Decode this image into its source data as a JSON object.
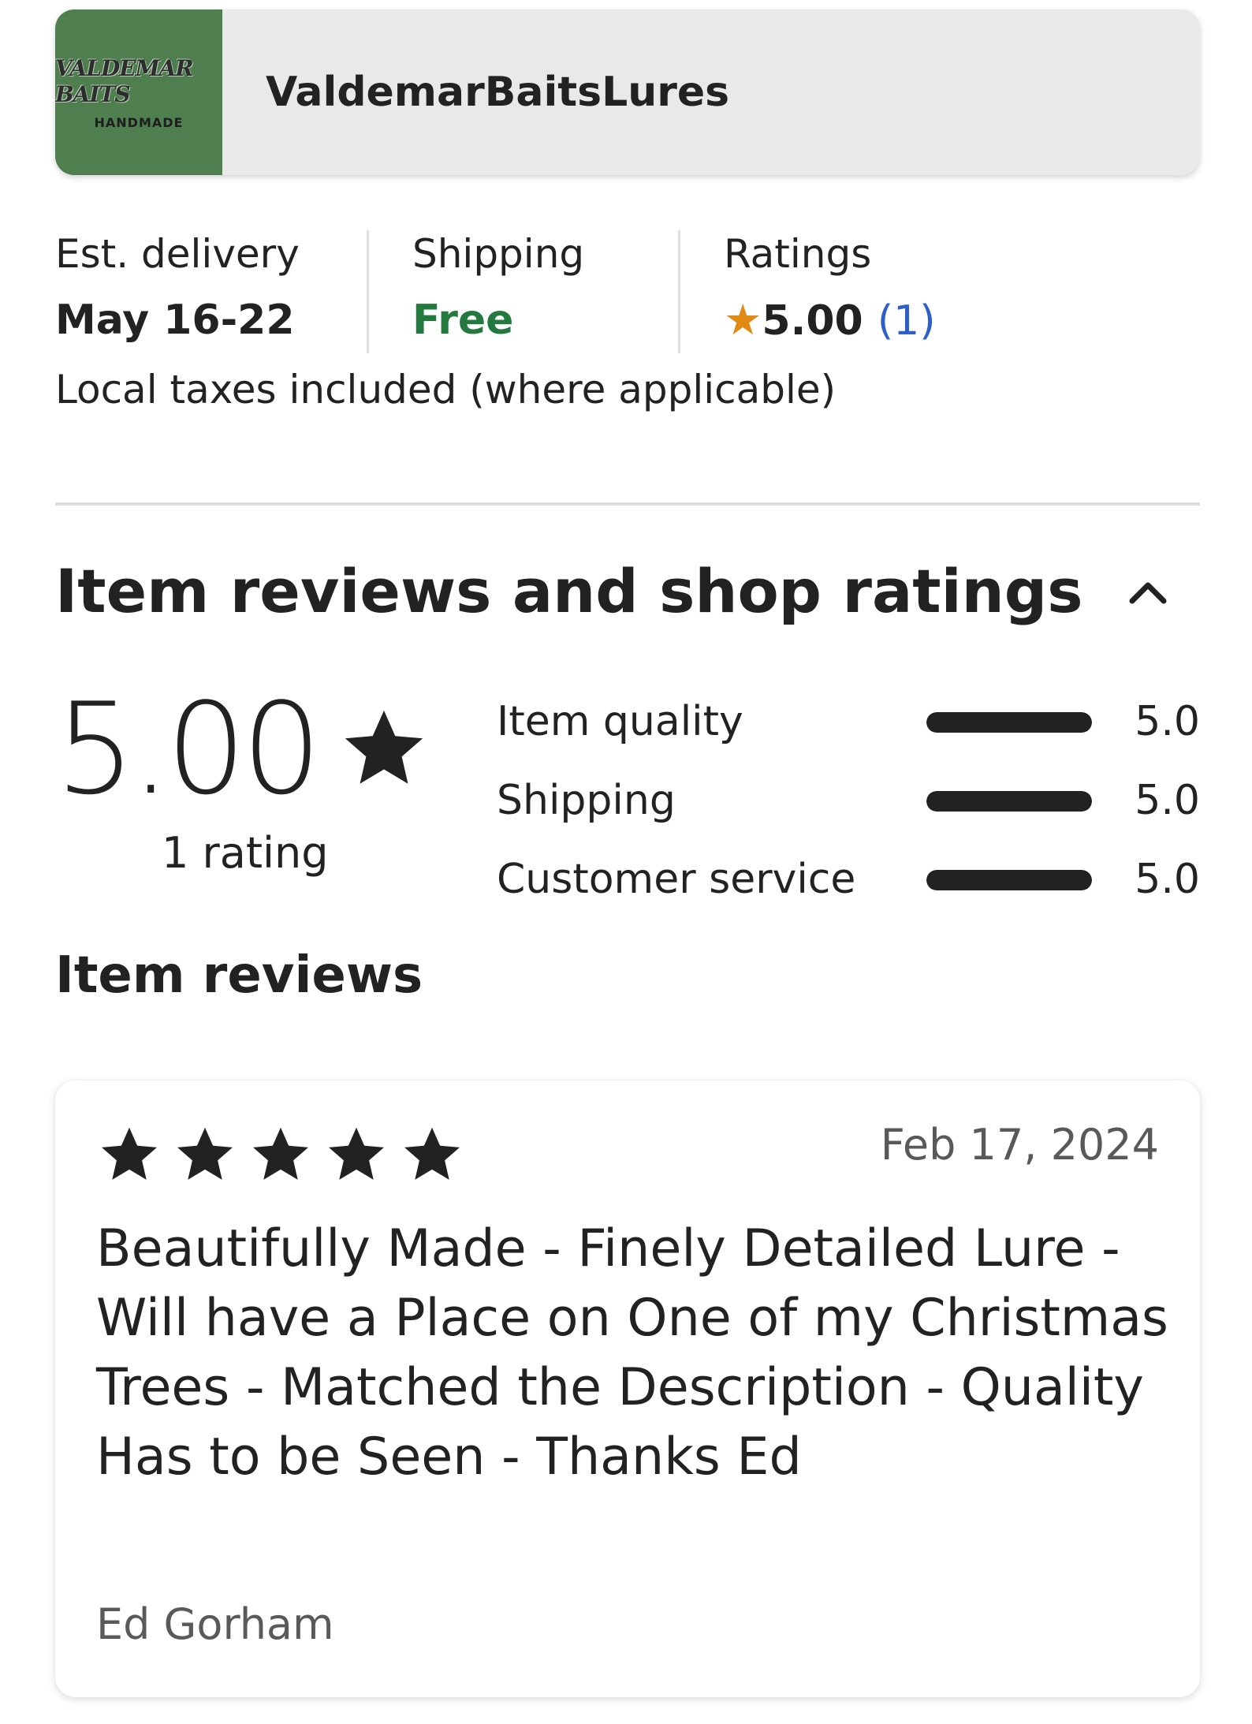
{
  "shop": {
    "logo_text": "VALDEMAR BAITS",
    "logo_subtext": "HANDMADE",
    "name": "ValdemarBaitsLures",
    "logo_color": "#4f7f4f"
  },
  "delivery": {
    "label": "Est. delivery",
    "value": "May 16-22"
  },
  "shipping": {
    "label": "Shipping",
    "value": "Free",
    "color": "#247a3e"
  },
  "ratings": {
    "label": "Ratings",
    "value": "5.00",
    "count": "(1)",
    "star_color": "#e08a14",
    "count_color": "#2e5fc9"
  },
  "taxes_note": "Local taxes included (where applicable)",
  "reviews_section": {
    "title": "Item reviews and shop ratings",
    "collapse_icon": "chevron-up-icon",
    "overall_rating": "5.00",
    "rating_count": "1 rating",
    "metrics": [
      {
        "label": "Item quality",
        "value": "5.0",
        "fill": 1.0
      },
      {
        "label": "Shipping",
        "value": "5.0",
        "fill": 1.0
      },
      {
        "label": "Customer service",
        "value": "5.0",
        "fill": 1.0
      }
    ]
  },
  "item_reviews": {
    "title": "Item reviews",
    "reviews": [
      {
        "stars": 5,
        "date": "Feb 17, 2024",
        "text": "Beautifully Made - Finely Detailed Lure - Will have a Place on One of my Christmas Trees - Matched the Description - Quality Has to be Seen - Thanks Ed",
        "author": "Ed Gorham"
      }
    ]
  }
}
